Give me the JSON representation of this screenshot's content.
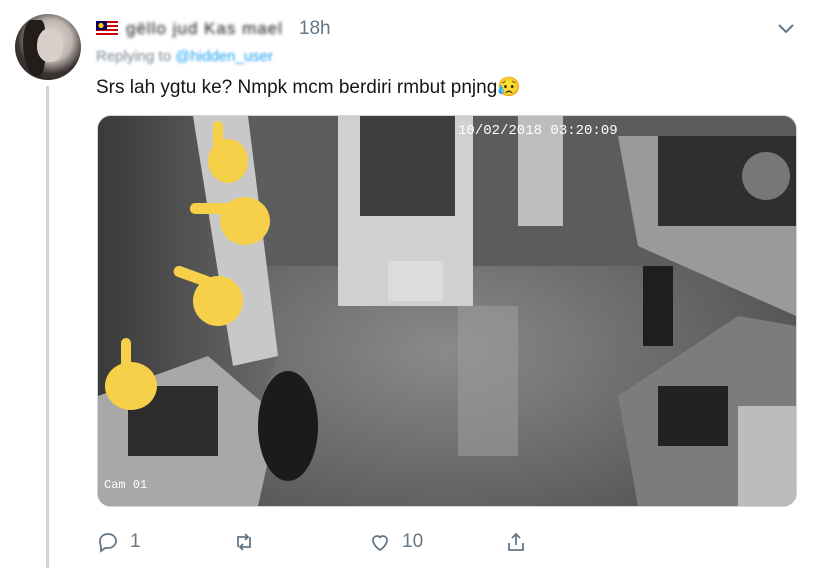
{
  "tweet": {
    "author_display": "gëllo jud Kas mael",
    "timestamp": "18h",
    "replying_to_prefix": "Replying to",
    "replying_to_handle": "@hidden_user",
    "text": "Srs lah ygtu ke? Nmpk mcm berdiri rmbut pnjng😥",
    "media": {
      "overlay_timestamp": "10/02/2018 03:20:09",
      "camera_label": "Cam 01"
    },
    "actions": {
      "reply_count": "1",
      "retweet_count": "",
      "like_count": "10"
    }
  },
  "icons": {
    "reply": "reply-icon",
    "retweet": "retweet-icon",
    "like": "heart-icon",
    "share": "share-icon",
    "menu": "chevron-down-icon",
    "pointer": "pointing-hand-emoji"
  },
  "colors": {
    "thread_line": "#ccd6dd",
    "secondary_text": "#657786",
    "link": "#1da1f2",
    "emoji_yellow": "#f7d04a"
  }
}
